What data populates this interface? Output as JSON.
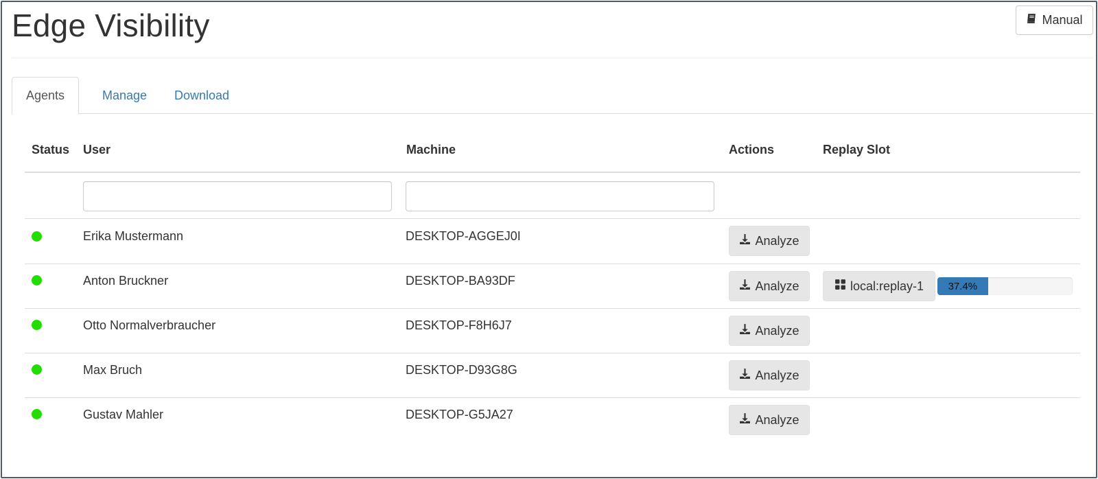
{
  "header": {
    "title": "Edge Visibility",
    "manual_label": "Manual",
    "manual_icon": "book-icon"
  },
  "tabs": [
    {
      "label": "Agents",
      "active": true
    },
    {
      "label": "Manage",
      "active": false
    },
    {
      "label": "Download",
      "active": false
    }
  ],
  "table": {
    "columns": {
      "status": "Status",
      "user": "User",
      "machine": "Machine",
      "actions": "Actions",
      "replay_slot": "Replay Slot"
    },
    "filters": {
      "user_value": "",
      "machine_value": ""
    },
    "action_label": "Analyze",
    "action_icon": "download-icon",
    "status_online_color": "#22dd00",
    "rows": [
      {
        "status": "online",
        "user": "Erika Mustermann",
        "machine": "DESKTOP-AGGEJ0I"
      },
      {
        "status": "online",
        "user": "Anton Bruckner",
        "machine": "DESKTOP-BA93DF",
        "replay_slot": {
          "label": "local:replay-1",
          "icon": "th-large-icon",
          "progress_text": "37.4%",
          "progress_fraction": 0.374
        }
      },
      {
        "status": "online",
        "user": "Otto Normalverbraucher",
        "machine": "DESKTOP-F8H6J7"
      },
      {
        "status": "online",
        "user": "Max Bruch",
        "machine": "DESKTOP-D93G8G"
      },
      {
        "status": "online",
        "user": "Gustav Mahler",
        "machine": "DESKTOP-G5JA27"
      }
    ]
  },
  "colors": {
    "link": "#337ab7",
    "progress_fill": "#337ab7"
  }
}
